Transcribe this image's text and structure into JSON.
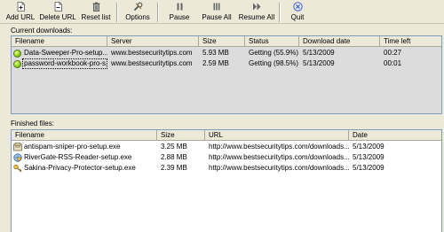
{
  "toolbar": {
    "add_url": "Add URL",
    "delete_url": "Delete URL",
    "reset_list": "Reset list",
    "options": "Options",
    "pause": "Pause",
    "pause_all": "Pause All",
    "resume_all": "Resume All",
    "quit": "Quit"
  },
  "current": {
    "label": "Current downloads:",
    "columns": [
      "Filename",
      "Server",
      "Size",
      "Status",
      "Download date",
      "Time left"
    ],
    "rows": [
      {
        "filename": "Data-Sweeper-Pro-setup...",
        "server": "www.bestsecuritytips.com",
        "size": "5.93 MB",
        "status": "Getting (55.9%)",
        "date": "5/13/2009",
        "time_left": "00:27"
      },
      {
        "filename": "password-workbook-pro-s...",
        "server": "www.bestsecuritytips.com",
        "size": "2.59 MB",
        "status": "Getting (98.5%)",
        "date": "5/13/2009",
        "time_left": "00:01"
      }
    ]
  },
  "finished": {
    "label": "Finished files:",
    "columns": [
      "Filename",
      "Size",
      "URL",
      "Date"
    ],
    "rows": [
      {
        "filename": "antispam-sniper-pro-setup.exe",
        "size": "3.25 MB",
        "url": "http://www.bestsecuritytips.com/downloads...",
        "date": "5/13/2009"
      },
      {
        "filename": "RiverGate-RSS-Reader-setup.exe",
        "size": "2.88 MB",
        "url": "http://www.bestsecuritytips.com/downloads...",
        "date": "5/13/2009"
      },
      {
        "filename": "Sakina-Privacy-Protector-setup.exe",
        "size": "2.39 MB",
        "url": "http://www.bestsecuritytips.com/downloads...",
        "date": "5/13/2009"
      }
    ]
  },
  "colors": {
    "window_bg": "#ece9d8",
    "current_list_bg": "#dcdcdc",
    "status_green": "#8fd21d",
    "quit_blue": "#2b4fc9"
  },
  "icons": {
    "add_url": "add-file-icon",
    "delete_url": "delete-file-icon",
    "reset_list": "trash-icon",
    "options": "wrench-icon",
    "pause": "pause-icon",
    "pause_all": "pause-all-icon",
    "resume_all": "resume-all-icon",
    "quit": "quit-icon"
  }
}
